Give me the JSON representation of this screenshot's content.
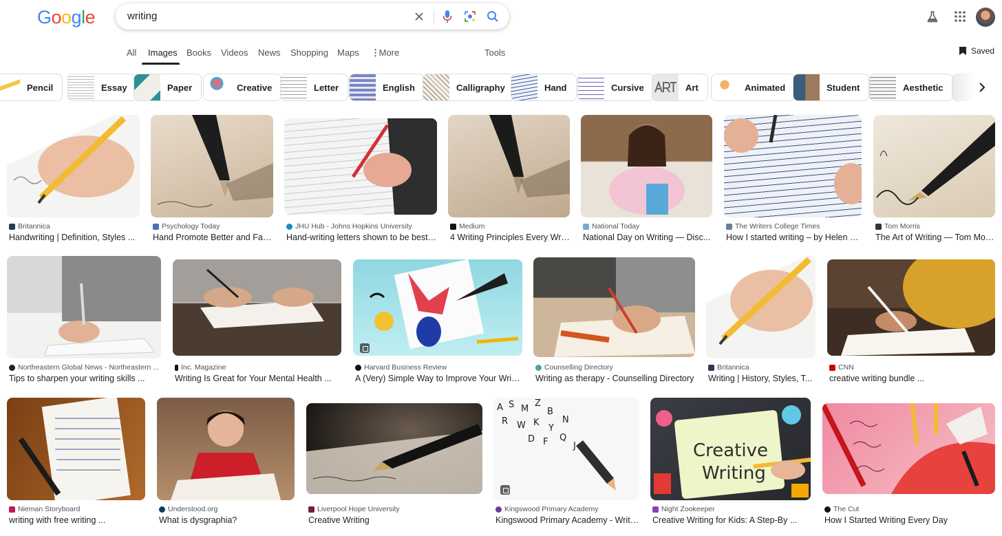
{
  "search": {
    "query": "writing"
  },
  "logo": {
    "letters": [
      "G",
      "o",
      "o",
      "g",
      "l",
      "e"
    ],
    "colors": [
      "#4285F4",
      "#EA4335",
      "#FBBC05",
      "#4285F4",
      "#34A853",
      "#EA4335"
    ]
  },
  "nav": {
    "tabs": [
      {
        "label": "All"
      },
      {
        "label": "Images"
      },
      {
        "label": "Books"
      },
      {
        "label": "Videos"
      },
      {
        "label": "News"
      },
      {
        "label": "Shopping"
      },
      {
        "label": "Maps"
      },
      {
        "label": "More"
      }
    ],
    "tools": "Tools",
    "saved": "Saved"
  },
  "chips": [
    {
      "label": "Pencil"
    },
    {
      "label": "Essay"
    },
    {
      "label": "Paper"
    },
    {
      "label": "Creative"
    },
    {
      "label": "Letter"
    },
    {
      "label": "English"
    },
    {
      "label": "Calligraphy"
    },
    {
      "label": "Hand"
    },
    {
      "label": "Cursive"
    },
    {
      "label": "Art"
    },
    {
      "label": "Animated"
    },
    {
      "label": "Student"
    },
    {
      "label": "Aesthetic"
    }
  ],
  "results": [
    {
      "source": "Britannica",
      "title": "Handwriting | Definition, Styles ..."
    },
    {
      "source": "Psychology Today",
      "title": "Hand Promote Better and Fas..."
    },
    {
      "source": "JHU Hub - Johns Hopkins University",
      "title": "Hand-writing letters shown to be best ..."
    },
    {
      "source": "Medium",
      "title": "4 Writing Principles Every Wri..."
    },
    {
      "source": "National Today",
      "title": "National Day on Writing — Disc..."
    },
    {
      "source": "The Writers College Times",
      "title": "How I started writing – by Helen B..."
    },
    {
      "source": "Tom Morris",
      "title": "The Art of Writing — Tom Morris"
    },
    {
      "source": "Northeastern Global News - Northeastern ...",
      "title": "Tips to sharpen your writing skills ..."
    },
    {
      "source": "Inc. Magazine",
      "title": "Writing Is Great for Your Mental Health ..."
    },
    {
      "source": "Harvard Business Review",
      "title": "A (Very) Simple Way to Improve Your Writing"
    },
    {
      "source": "Counselling Directory",
      "title": "Writing as therapy - Counselling Directory"
    },
    {
      "source": "Britannica",
      "title": "Writing | History, Styles, T..."
    },
    {
      "source": "CNN",
      "title": "creative writing bundle ..."
    },
    {
      "source": "Nieman Storyboard",
      "title": "writing with free writing ..."
    },
    {
      "source": "Understood.org",
      "title": "What is dysgraphia?"
    },
    {
      "source": "Liverpool Hope University",
      "title": "Creative Writing"
    },
    {
      "source": "Kingswood Primary Academy",
      "title": "Kingswood Primary Academy - Writing"
    },
    {
      "source": "Night Zookeeper",
      "title": "Creative Writing for Kids: A Step-By ..."
    },
    {
      "source": "The Cut",
      "title": "How I Started Writing Every Day"
    }
  ]
}
